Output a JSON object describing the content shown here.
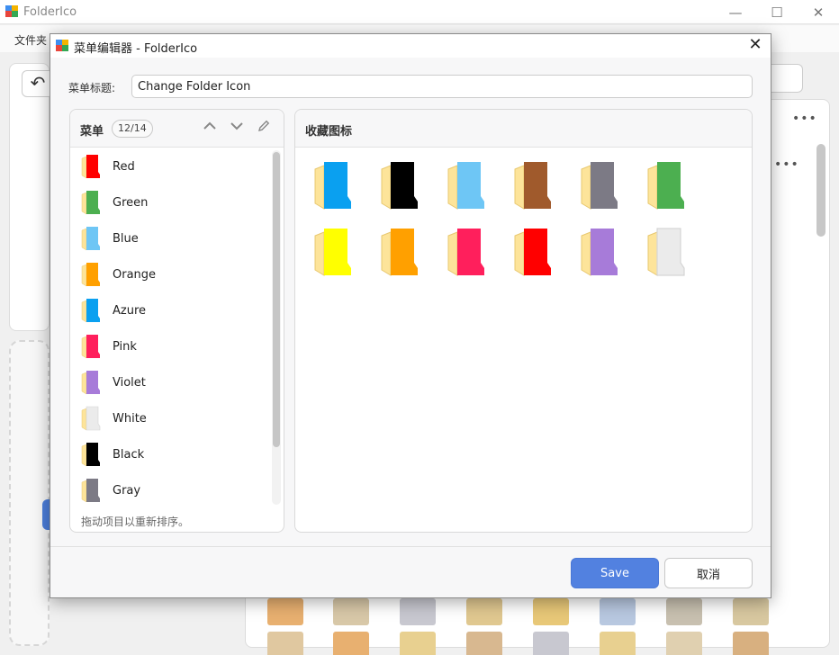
{
  "app": {
    "title": "FolderIco",
    "menu_item": "文件夹"
  },
  "dialog": {
    "title": "菜单编辑器 - FolderIco",
    "menu_title_label": "菜单标题:",
    "menu_title_value": "Change Folder Icon",
    "menu_panel": {
      "title": "菜单",
      "count": "12/14",
      "hint": "拖动项目以重新排序。",
      "items": [
        {
          "label": "Red",
          "color": "#ff0000"
        },
        {
          "label": "Green",
          "color": "#4caf50"
        },
        {
          "label": "Blue",
          "color": "#6ec6f5"
        },
        {
          "label": "Orange",
          "color": "#ffa000"
        },
        {
          "label": "Azure",
          "color": "#0aa0f0"
        },
        {
          "label": "Pink",
          "color": "#ff1f5c"
        },
        {
          "label": "Violet",
          "color": "#a77bd9"
        },
        {
          "label": "White",
          "color": "#ebebeb"
        },
        {
          "label": "Black",
          "color": "#000000"
        },
        {
          "label": "Gray",
          "color": "#7c7a85"
        }
      ]
    },
    "favorites_panel": {
      "title": "收藏图标",
      "icons": [
        {
          "color": "#0aa0f0"
        },
        {
          "color": "#000000"
        },
        {
          "color": "#6ec6f5"
        },
        {
          "color": "#a05a2c"
        },
        {
          "color": "#7c7a85"
        },
        {
          "color": "#4caf50"
        },
        {
          "color": "#ffff00"
        },
        {
          "color": "#ffa000"
        },
        {
          "color": "#ff1f5c"
        },
        {
          "color": "#ff0000"
        },
        {
          "color": "#a77bd9"
        },
        {
          "color": "#ebebeb"
        }
      ]
    },
    "buttons": {
      "save": "Save",
      "cancel": "取消"
    }
  },
  "colors": {
    "accent": "#5281e0",
    "folder_back": "#fde49a"
  }
}
